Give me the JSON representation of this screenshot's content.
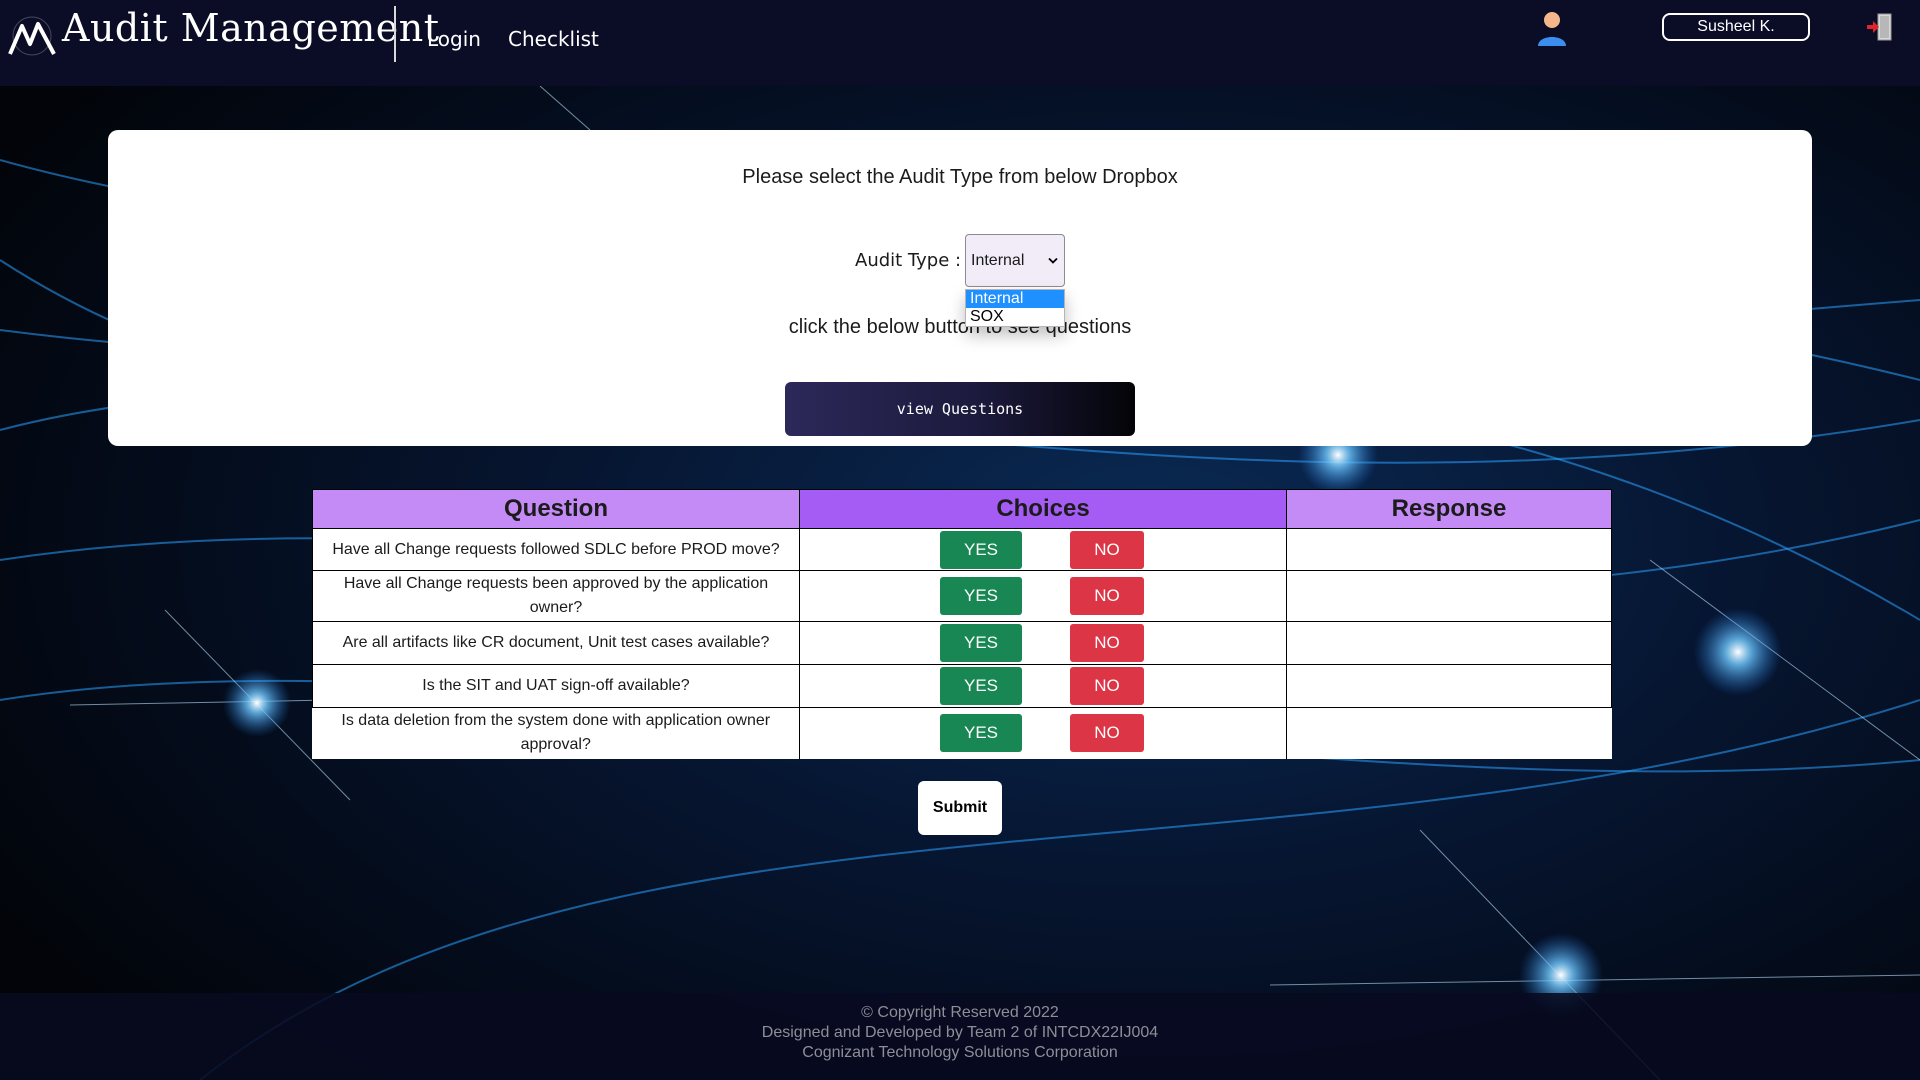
{
  "navbar": {
    "brand": "Audit Management",
    "links": [
      {
        "label": "Login"
      },
      {
        "label": "Checklist"
      }
    ],
    "user_name": "Susheel K."
  },
  "selection_card": {
    "instruction": "Please select the Audit Type from below Dropbox",
    "audit_type_label": "Audit Type :",
    "audit_type_value": "Internal",
    "audit_type_options": [
      "Internal",
      "SOX"
    ],
    "hint_text": "click the below button to see questions",
    "view_button_label": "view Questions"
  },
  "table": {
    "headers": [
      "Question",
      "Choices",
      "Response"
    ],
    "yes_label": "YES",
    "no_label": "NO",
    "rows": [
      {
        "question": "Have all Change requests followed SDLC before PROD move?",
        "response": ""
      },
      {
        "question": "Have all Change requests been approved by the application owner?",
        "response": ""
      },
      {
        "question": "Are all artifacts like CR document, Unit test cases available?",
        "response": ""
      },
      {
        "question": "Is the SIT and UAT sign-off available?",
        "response": ""
      },
      {
        "question": "Is data deletion from the system done with application owner approval?",
        "response": ""
      }
    ]
  },
  "submit_label": "Submit",
  "footer": {
    "lines": [
      "© Copyright Reserved 2022",
      "Designed and Developed by Team 2 of INTCDX22IJ004",
      "Cognizant Technology Solutions Corporation"
    ]
  },
  "colors": {
    "navbar_bg": "#0b0c26",
    "header_light": "#c48bf7",
    "header_dark": "#a55cf5",
    "yes_green": "#198754",
    "no_red": "#dc3545",
    "option_highlight": "#1e90ff"
  },
  "icons": {
    "logo": "mountain-logo-icon",
    "user": "user-avatar-icon",
    "logout": "logout-icon",
    "select": "chevron-down-icon"
  }
}
